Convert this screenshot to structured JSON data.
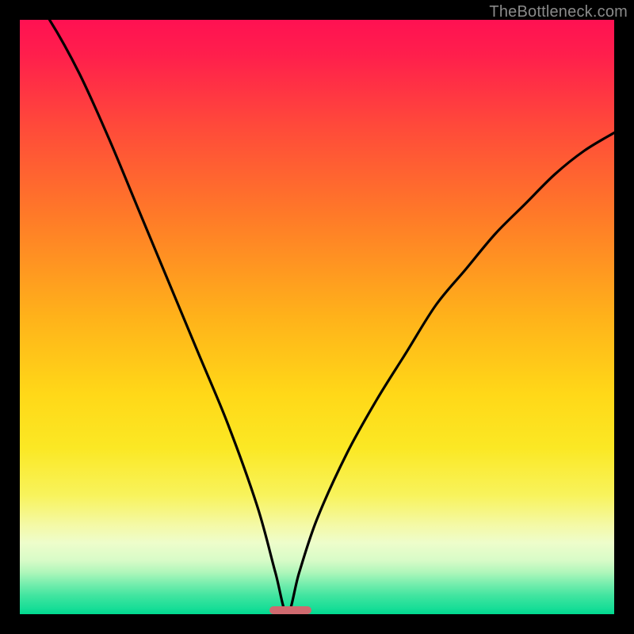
{
  "watermark": "TheBottleneck.com",
  "colors": {
    "background": "#000000",
    "marker": "#cf6a6f",
    "curve": "#000000",
    "gradient_top": "#ff1152",
    "gradient_bottom": "#00d98f"
  },
  "chart_data": {
    "type": "line",
    "title": "",
    "xlabel": "",
    "ylabel": "",
    "xlim": [
      0,
      100
    ],
    "ylim": [
      0,
      100
    ],
    "optimal_x": 45,
    "marker": {
      "x_start": 42,
      "x_end": 49,
      "height_pct": 1.3
    },
    "series": [
      {
        "name": "bottleneck-curve",
        "x": [
          0,
          5,
          10,
          15,
          20,
          25,
          30,
          35,
          40,
          43,
          45,
          47,
          50,
          55,
          60,
          65,
          70,
          75,
          80,
          85,
          90,
          95,
          100
        ],
        "values": [
          107,
          100,
          91,
          80,
          68,
          56,
          44,
          32,
          18,
          7,
          0,
          7,
          16,
          27,
          36,
          44,
          52,
          58,
          64,
          69,
          74,
          78,
          81
        ]
      }
    ],
    "annotations": []
  }
}
